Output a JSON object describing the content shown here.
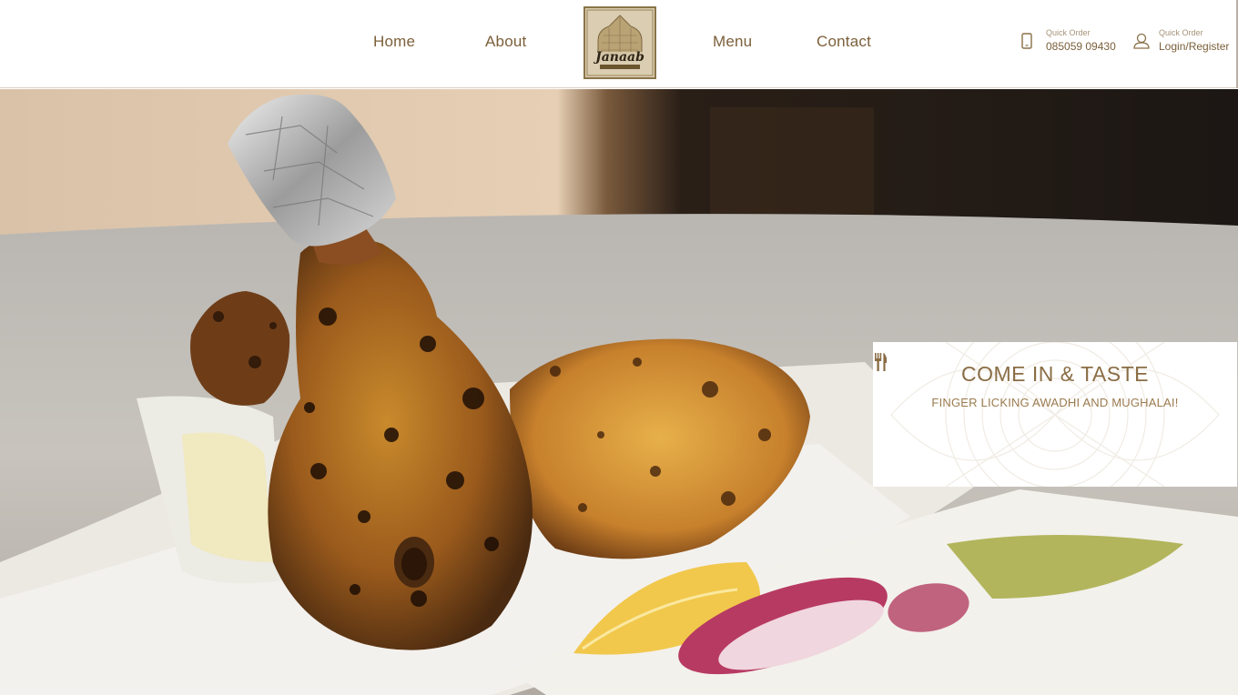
{
  "nav": {
    "items": [
      {
        "label": "Home"
      },
      {
        "label": "About"
      },
      {
        "label": "Menu"
      },
      {
        "label": "Contact"
      }
    ]
  },
  "logo": {
    "brand_text": "Janaab",
    "icon": "restaurant-logo"
  },
  "quick_phone": {
    "small_label": "Quick Order",
    "value": "085059 09430",
    "icon": "mobile-phone-icon"
  },
  "quick_login": {
    "small_label": "Quick Order",
    "value": "Login/Register",
    "icon": "user-icon"
  },
  "promo": {
    "title": "COME IN & TASTE",
    "icon": "cutlery-icon",
    "subtitle": "FINGER LICKING AWADHI AND MUGHALAI!"
  },
  "colors": {
    "accent": "#7b5f3a",
    "muted": "#a69378",
    "header_bg": "#ffffff"
  }
}
